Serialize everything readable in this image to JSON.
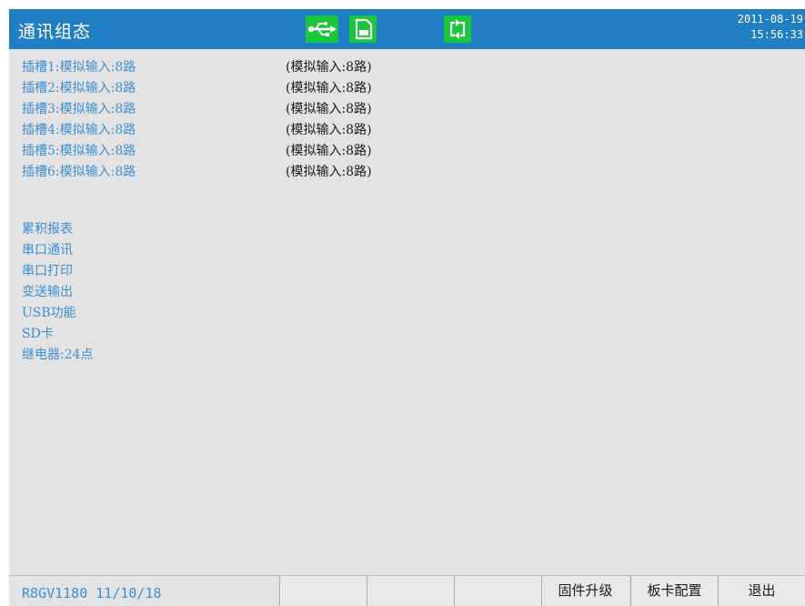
{
  "header": {
    "title": "通讯组态",
    "date": "2011-08-19",
    "time": "15:56:33",
    "accent_color": "#1f7fc2",
    "icon_color": "#18c83a",
    "icons": [
      "usb-icon",
      "sd-card-icon",
      "sync-icon"
    ]
  },
  "slots": [
    {
      "label": "插槽1:模拟输入:8路",
      "actual": "(模拟输入:8路)"
    },
    {
      "label": "插槽2:模拟输入:8路",
      "actual": "(模拟输入:8路)"
    },
    {
      "label": "插槽3:模拟输入:8路",
      "actual": "(模拟输入:8路)"
    },
    {
      "label": "插槽4:模拟输入:8路",
      "actual": "(模拟输入:8路)"
    },
    {
      "label": "插槽5:模拟输入:8路",
      "actual": "(模拟输入:8路)"
    },
    {
      "label": "插槽6:模拟输入:8路",
      "actual": "(模拟输入:8路)"
    }
  ],
  "functions": [
    "累积报表",
    "串口通讯",
    "串口打印",
    "变送输出",
    "USB功能",
    "SD卡",
    "继电器:24点"
  ],
  "footer": {
    "version": "R8GV1180 11/10/18",
    "buttons": [
      "",
      "",
      "",
      "固件升级",
      "板卡配置",
      "退出"
    ]
  }
}
